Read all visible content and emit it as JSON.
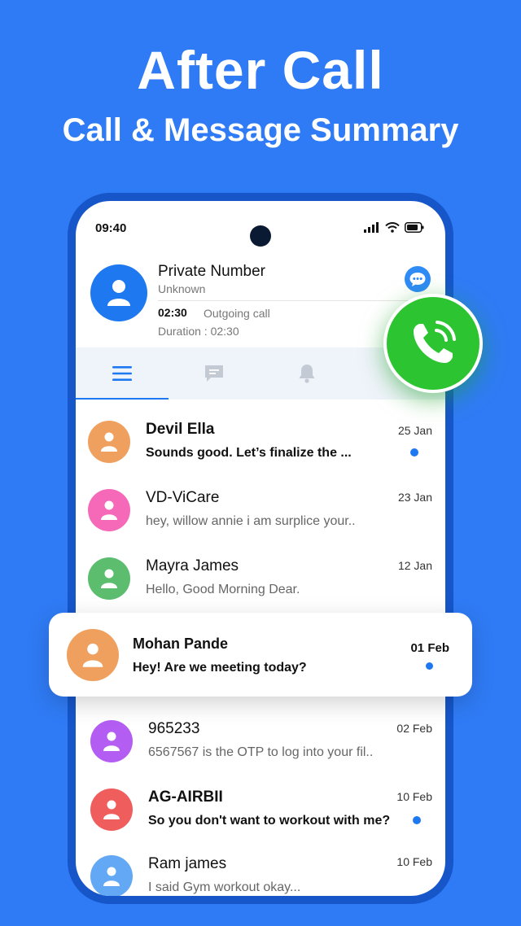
{
  "headline": {
    "title": "After Call",
    "subtitle": "Call & Message Summary"
  },
  "status_bar": {
    "time": "09:40",
    "icons": [
      "signal-icon",
      "wifi-icon",
      "battery-icon"
    ]
  },
  "call_summary": {
    "name": "Private Number",
    "label": "Unknown",
    "time": "02:30",
    "type": "Outgoing call",
    "duration": "Duration : 02:30"
  },
  "tabs": [
    {
      "icon": "menu-icon",
      "active": true
    },
    {
      "icon": "message-icon",
      "active": false
    },
    {
      "icon": "bell-icon",
      "active": false
    }
  ],
  "colors": {
    "background": "#2F7BF5",
    "phone_frame": "#1656C9",
    "accent": "#1E78F0",
    "call_green": "#2CC531"
  },
  "messages": [
    {
      "name": "Devil Ella",
      "message": "Sounds good. Let’s finalize the ...",
      "date": "25 Jan",
      "unread": true,
      "avatar_color": "#F0A05E"
    },
    {
      "name": "VD-ViCare",
      "message": "hey, willow annie i am surplice your..",
      "date": "23 Jan",
      "unread": false,
      "avatar_color": "#F569B8"
    },
    {
      "name": "Mayra James",
      "message": "Hello, Good Morning Dear.",
      "date": "12 Jan",
      "unread": false,
      "avatar_color": "#5CBD6E"
    },
    {
      "name": "965233",
      "message": "6567567 is the OTP to log into your fil..",
      "date": "02 Feb",
      "unread": false,
      "avatar_color": "#B45DF2"
    },
    {
      "name": "AG-AIRBII",
      "message": "So you don't want to workout with me?",
      "date": "10 Feb",
      "unread": true,
      "avatar_color": "#F05D5D"
    },
    {
      "name": "Ram james",
      "message": "I said Gym workout okay...",
      "date": "10 Feb",
      "unread": false,
      "avatar_color": "#63A8F4"
    }
  ],
  "highlighted": {
    "name": "Mohan Pande",
    "message": "Hey! Are we meeting today?",
    "date": "01 Feb",
    "unread": true,
    "avatar_color": "#F0A05E"
  }
}
